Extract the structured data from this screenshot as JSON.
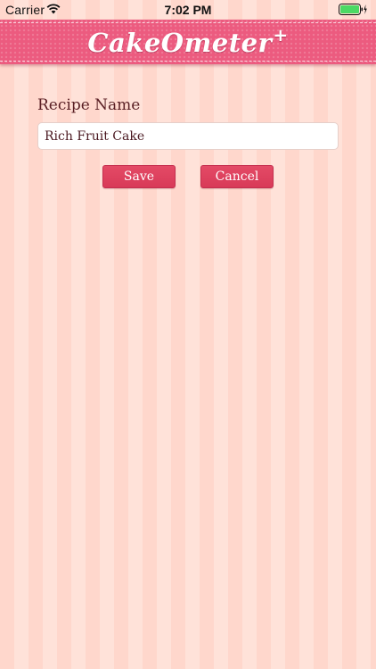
{
  "status_bar": {
    "carrier": "Carrier",
    "time": "7:02 PM",
    "battery_level": 1.0,
    "icons": [
      "wifi-icon",
      "battery-icon",
      "charging-bolt-icon"
    ]
  },
  "header": {
    "title": "CakeOmeter",
    "title_suffix": "+"
  },
  "form": {
    "label": "Recipe Name",
    "recipe_name_value": "Rich Fruit Cake",
    "save_label": "Save",
    "cancel_label": "Cancel"
  },
  "colors": {
    "header": "#ec5b7f",
    "button": "#e04462",
    "stripe_light": "#ffe2d9",
    "stripe_dark": "#ffd7cc",
    "label_text": "#5a1f24",
    "battery_fill": "#4cd964"
  }
}
